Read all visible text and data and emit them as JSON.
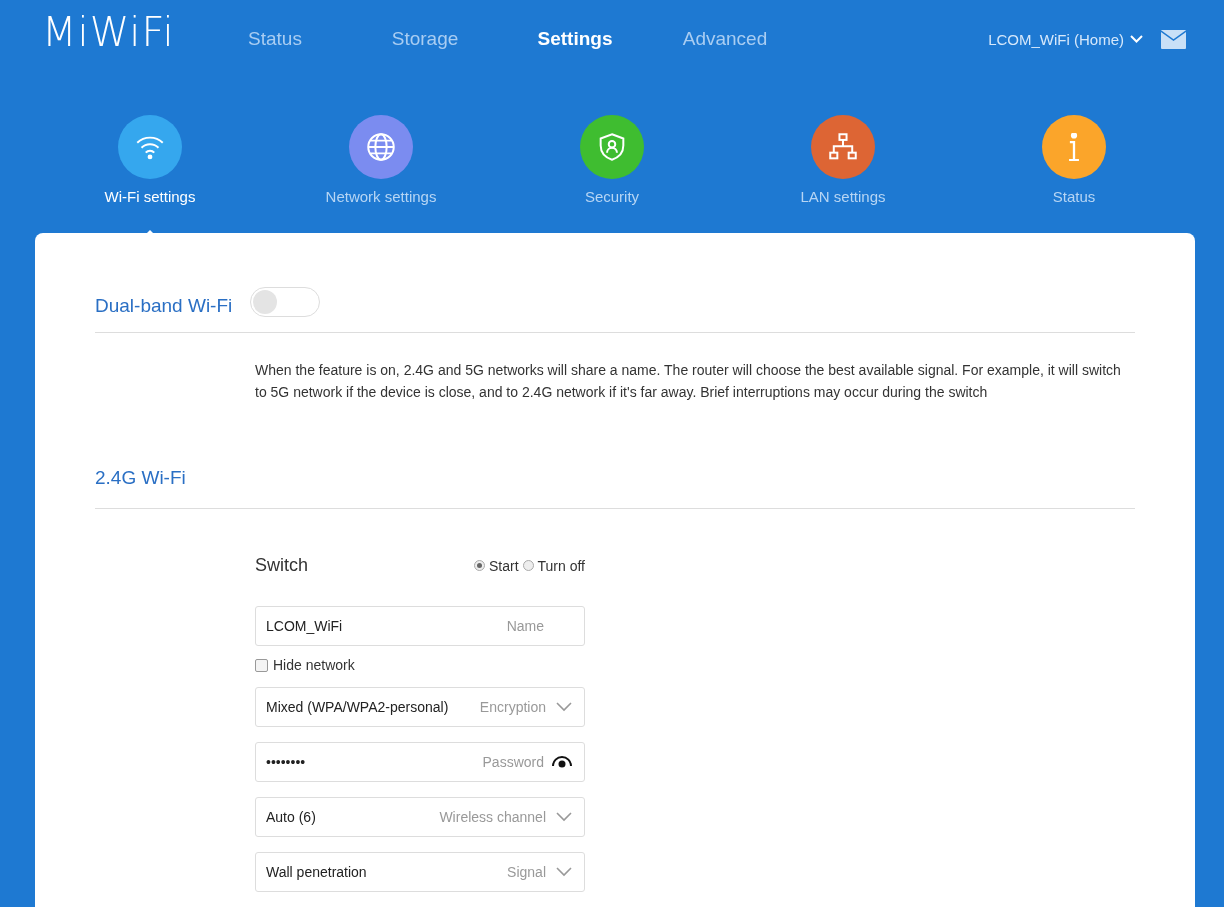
{
  "logo": "MiWiFi",
  "nav": [
    {
      "label": "Status",
      "selected": false
    },
    {
      "label": "Storage",
      "selected": false
    },
    {
      "label": "Settings",
      "selected": true
    },
    {
      "label": "Advanced",
      "selected": false
    }
  ],
  "router": "LCOM_WiFi (Home)",
  "categories": [
    {
      "kind": "wifi",
      "label": "Wi-Fi settings",
      "color": "#35a7ee",
      "selected": true
    },
    {
      "kind": "globe",
      "label": "Network settings",
      "color": "#7b8cf0",
      "selected": false
    },
    {
      "kind": "shield",
      "label": "Security",
      "color": "#3fbd30",
      "selected": false
    },
    {
      "kind": "lan",
      "label": "LAN settings",
      "color": "#dd6534",
      "selected": false
    },
    {
      "kind": "info",
      "label": "Status",
      "color": "#fba52a",
      "selected": false
    }
  ],
  "dual_band": {
    "title": "Dual-band Wi-Fi",
    "on": false,
    "description": "When the feature is on, 2.4G and 5G networks will share a name. The router will choose the best available signal. For example, it will switch to 5G network if the device is close, and to 2.4G network if it's far away. Brief interruptions may occur during the switch"
  },
  "wifi_24": {
    "title": "2.4G Wi-Fi",
    "switch_label": "Switch",
    "switch_options": [
      {
        "label": "Start",
        "selected": true
      },
      {
        "label": "Turn off",
        "selected": false
      }
    ],
    "fields": [
      {
        "kind": "text",
        "value": "LCOM_WiFi",
        "caption": "Name"
      },
      {
        "kind": "checkbox",
        "label": "Hide network",
        "checked": false
      },
      {
        "kind": "select",
        "value": "Mixed (WPA/WPA2-personal)",
        "caption": "Encryption"
      },
      {
        "kind": "password",
        "value": "••••••••",
        "caption": "Password"
      },
      {
        "kind": "select",
        "value": "Auto (6)",
        "caption": "Wireless channel"
      },
      {
        "kind": "select",
        "value": "Wall penetration",
        "caption": "Signal"
      }
    ]
  }
}
